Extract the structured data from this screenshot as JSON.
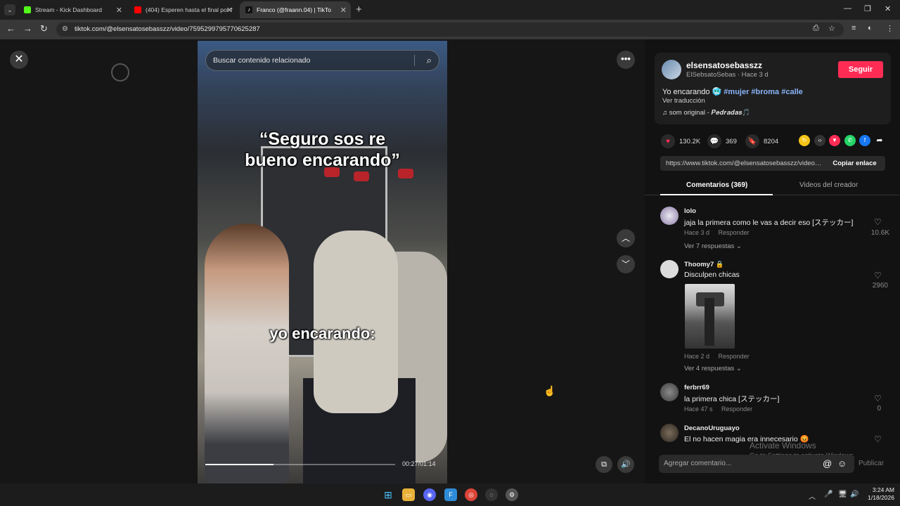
{
  "browser": {
    "tabs": [
      {
        "title": "Stream - Kick Dashboard",
        "icon_color": "#53fc18"
      },
      {
        "title": "(404) Esperen hasta el final por f",
        "icon_color": "#ff0000"
      },
      {
        "title": "Franco (@fraann.04) | TikTo",
        "icon_color": "#ffffff"
      }
    ],
    "url": "tiktok.com/@elsensatosebasszz/video/7595299795770625287"
  },
  "video": {
    "search_placeholder": "Buscar contenido relacionado",
    "caption_top": "“Seguro sos re bueno encarando”",
    "caption_mid": "yo encarando:",
    "time": "00:27/01:14",
    "progress_fraction": 0.36
  },
  "author": {
    "username": "elsensatosebasszz",
    "sub": "ElSebsatoSebas · Hace 3 d",
    "follow_label": "Seguir",
    "desc_text": "Yo encarando 🥶 ",
    "hashtags": "#mujer #broma #calle",
    "translate": "Ver traducción",
    "music": "♫  som original - 𝑷𝒆𝒅𝒓𝒂𝒅𝒂𝒔🎵"
  },
  "stats": {
    "likes": "130.2K",
    "comments": "369",
    "saves": "8204"
  },
  "share": {
    "link": "https://www.tiktok.com/@elsensatosebasszz/video/7595299795770625287",
    "copy_label": "Copiar enlace"
  },
  "panel_tabs": {
    "comments": "Comentarios (369)",
    "creator_videos": "Videos del creador"
  },
  "comments": [
    {
      "user": "lolo",
      "text": "jaja la primera como le vas a decir eso [ステッカー]",
      "meta_time": "Hace 3 d",
      "reply": "Responder",
      "replies": "Ver 7 respuestas ⌄",
      "likes": "10.6K"
    },
    {
      "user": "Thoomy7 🔒",
      "text": "Disculpen chicas",
      "meta_time": "Hace 2 d",
      "reply": "Responder",
      "replies": "Ver 4 respuestas ⌄",
      "likes": "2960"
    },
    {
      "user": "ferbrr69",
      "text": "la primera chica [ステッカー]",
      "meta_time": "Hace 47 s",
      "reply": "Responder",
      "likes": "0"
    },
    {
      "user": "DecanoUruguayo",
      "text": "El no hacen magia era innecesario 😡"
    }
  ],
  "watermark": {
    "line1": "Activate Windows",
    "line2": "Go to Settings to activate Windows."
  },
  "comment_input": {
    "placeholder": "Agregar comentario...",
    "publish": "Publicar"
  },
  "clock": {
    "time": "3:24 AM",
    "date": "1/18/2026"
  },
  "colors": {
    "accent": "#fe2c55",
    "hashtag": "#8ab4f8",
    "background": "#121212"
  }
}
